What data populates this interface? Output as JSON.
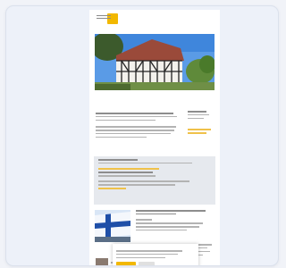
{
  "window": {
    "title": ""
  },
  "site": {
    "logo_name": "building-logo-icon",
    "nav_items": [
      "",
      "",
      "",
      "",
      ""
    ],
    "nav_row2": "",
    "subnav_items": [
      "",
      "",
      "",
      "",
      ""
    ]
  },
  "sidebar": {
    "heading": ""
  },
  "sections": {
    "news_heading": ""
  },
  "cookie_banner": {
    "title": "",
    "accept_label": "",
    "decline_label": ""
  },
  "colors": {
    "accent": "#f2b800",
    "page_bg": "#ffffff",
    "card_bg": "#edf1f9",
    "panel_grey": "#e6e9ee"
  },
  "icons": {
    "hero_image": "half-timbered-house-photo",
    "news_image": "finland-flag-photo",
    "bottom_image": "small-thumbnail-photo"
  }
}
